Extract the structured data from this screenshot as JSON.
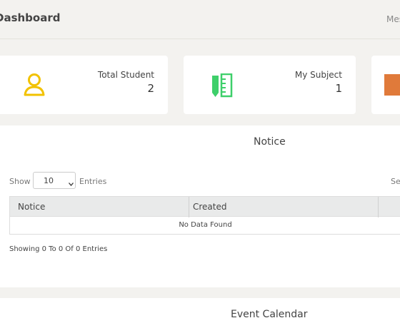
{
  "header": {
    "title": "Dashboard",
    "right_text": "Mes"
  },
  "cards": [
    {
      "label": "Total Student",
      "value": "2",
      "icon": "user-icon",
      "color": "#f2c200"
    },
    {
      "label": "My Subject",
      "value": "1",
      "icon": "subject-icon",
      "color": "#3ecf6a"
    },
    {
      "label": "",
      "value": "",
      "icon": "book-icon",
      "color": "#e07a3a"
    }
  ],
  "notice": {
    "title": "Notice",
    "show_label": "Show",
    "page_size": "10",
    "entries_label": "Entries",
    "search_label": "Se",
    "columns": [
      "Notice",
      "Created"
    ],
    "empty_text": "No Data Found",
    "footer": "Showing 0 To 0 Of 0 Entries"
  },
  "event": {
    "title": "Event Calendar"
  }
}
